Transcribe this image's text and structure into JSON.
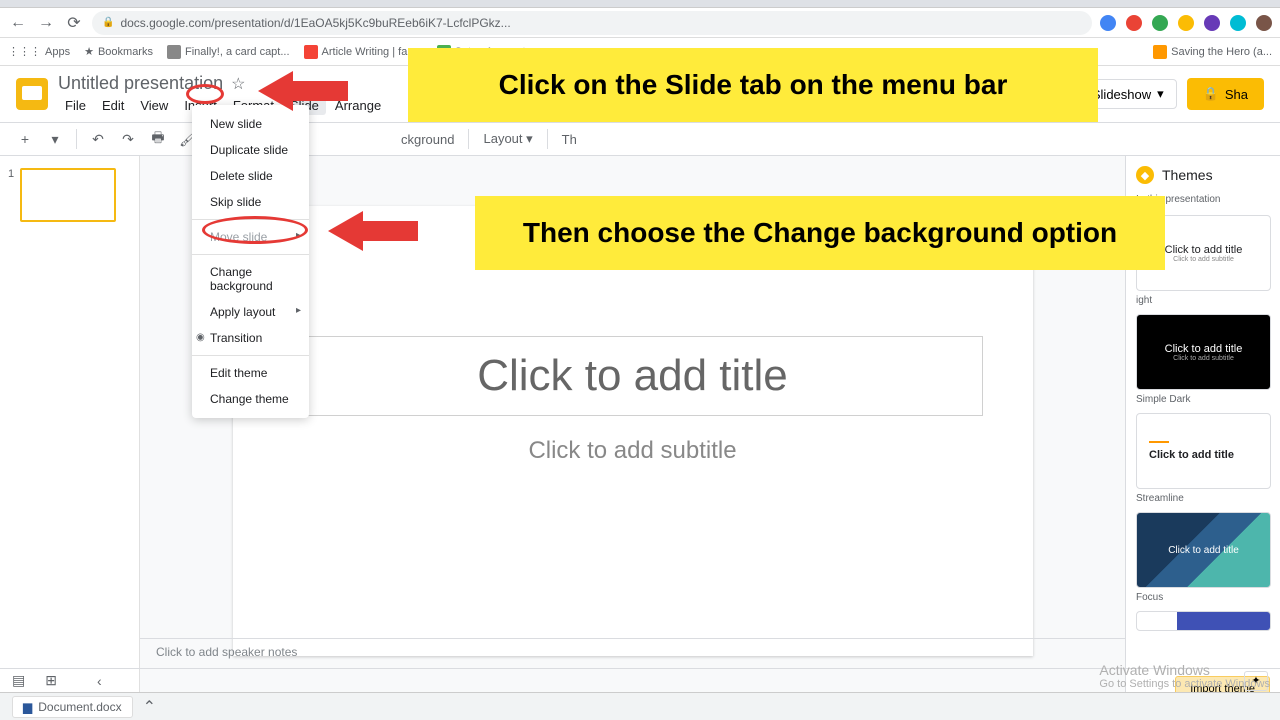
{
  "browser": {
    "url": "docs.google.com/presentation/d/1EaOA5kj5Kc9buREeb6iK7-LcfclPGkz...",
    "bookmarks": [
      "Apps",
      "Bookmarks",
      "Finally!, a card capt...",
      "Article Writing | fan...",
      "Setup Account...",
      "Saving the Hero (a..."
    ]
  },
  "doc": {
    "title": "Untitled presentation",
    "menus": [
      "File",
      "Edit",
      "View",
      "Insert",
      "Format",
      "Slide",
      "Arrange"
    ],
    "slideshow": "Slideshow",
    "share": "Sha"
  },
  "toolbar": {
    "background": "ckground",
    "layout": "Layout",
    "theme": "Th"
  },
  "dropdown": {
    "items": [
      "New slide",
      "Duplicate slide",
      "Delete slide",
      "Skip slide",
      "Move slide",
      "Change background",
      "Apply layout",
      "Transition",
      "Edit theme",
      "Change theme"
    ]
  },
  "slide": {
    "title_placeholder": "Click to add title",
    "subtitle_placeholder": "Click to add subtitle"
  },
  "callouts": {
    "c1": "Click on the Slide tab on the menu bar",
    "c2": "Then choose the Change background option"
  },
  "themes": {
    "header": "Themes",
    "sub": "In this presentation",
    "t1_title": "Click to add title",
    "t1_sub": "Click to add subtitle",
    "t1_name": "ight",
    "t2_title": "Click to add title",
    "t2_sub": "Click to add subtitle",
    "t2_name": "Simple Dark",
    "t3_title": "Click to add title",
    "t3_name": "Streamline",
    "t4_title": "Click to add title",
    "t4_name": "Focus",
    "import": "Import theme"
  },
  "notes": "Click to add speaker notes",
  "activate": {
    "line1": "Activate Windows",
    "line2": "Go to Settings to activate Windows"
  },
  "taskbar": {
    "doc": "Document.docx"
  }
}
